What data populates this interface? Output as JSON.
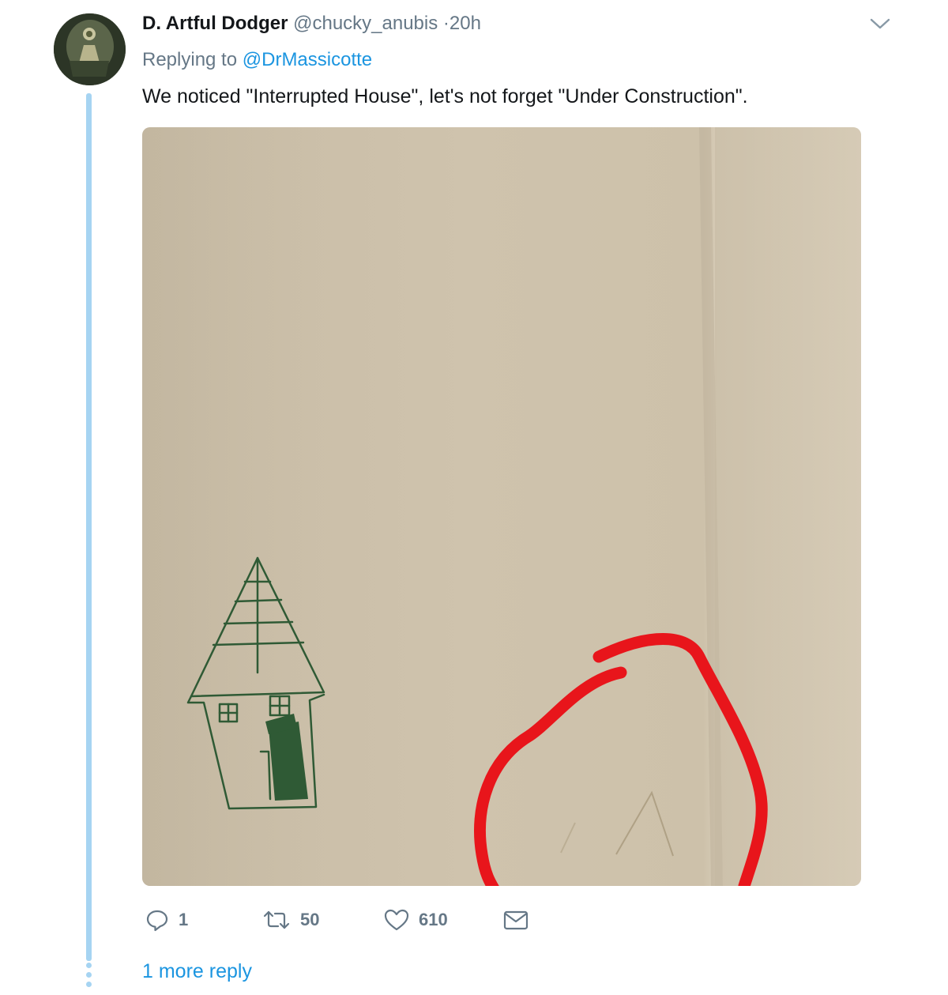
{
  "tweet": {
    "author_name": "D. Artful Dodger",
    "handle": "@chucky_anubis",
    "separator": "·",
    "time": "20h",
    "replying_prefix": "Replying to",
    "replying_to": "@DrMassicotte",
    "text": "We noticed \"Interrupted House\", let's not forget \"Under Construction\".",
    "media": {
      "description_icon": "photo",
      "highlight_color": "#e8151b",
      "drawing_color": "#2f5a35"
    }
  },
  "actions": {
    "reply_count": "1",
    "retweet_count": "50",
    "like_count": "610"
  },
  "thread": {
    "more_replies_label": "1 more reply"
  },
  "colors": {
    "link": "#1b95e0",
    "muted": "#657786",
    "thread_line": "#a6d4f2",
    "text": "#14171a"
  },
  "icons": [
    "chevron-down-icon",
    "reply-icon",
    "retweet-icon",
    "heart-icon",
    "mail-icon"
  ]
}
